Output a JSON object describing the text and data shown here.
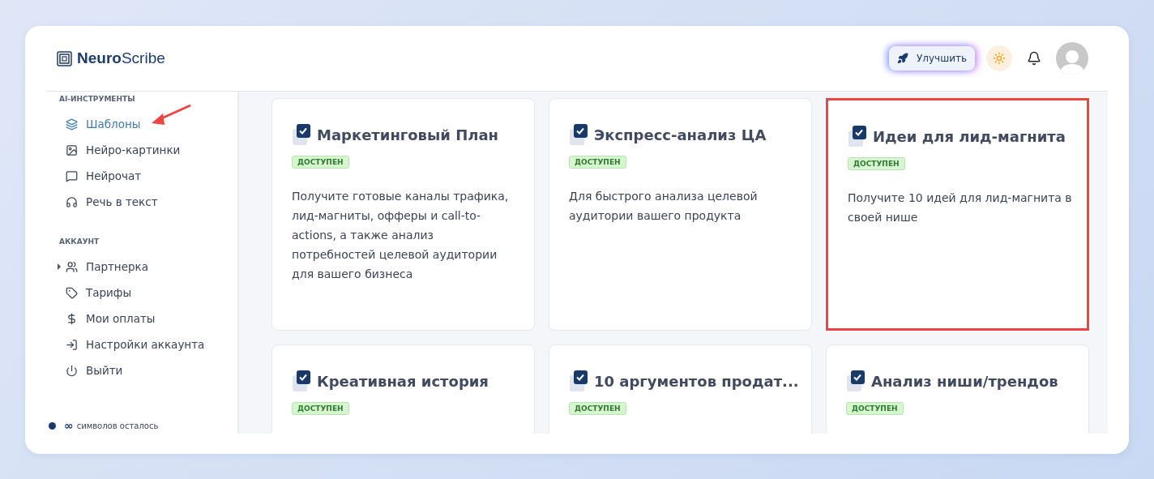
{
  "brand": {
    "name": "**Neuro**Scribe"
  },
  "header": {
    "upgrade_button": "Улучшить"
  },
  "sidebar": {
    "sections": [
      {
        "title": "AI-ИНСТРУМЕНТЫ",
        "items": [
          {
            "label": "Шаблоны",
            "selected": true
          },
          {
            "label": "Нейро-картинки",
            "selected": false
          },
          {
            "label": "Нейрочат",
            "selected": false
          },
          {
            "label": "Речь в текст",
            "selected": false
          }
        ]
      },
      {
        "title": "АККАУНТ",
        "items": [
          {
            "label": "Партнерка",
            "selected": false,
            "expanded": false
          },
          {
            "label": "Тарифы",
            "selected": false
          },
          {
            "label": "Мои оплаты",
            "selected": false
          },
          {
            "label": "Настройки аккаунта",
            "selected": false
          },
          {
            "label": "Выйти",
            "selected": false
          }
        ]
      }
    ],
    "footer": {
      "symbol": "∞",
      "text": "символов осталось"
    }
  },
  "cards": [
    {
      "title": "Маркетинговый План",
      "badge": "ДОСТУПЕН",
      "description": "Получите готовые каналы трафика, лид-магниты, офферы и call-to-actions, а также анализ потребностей целевой аудитории для вашего бизнеса",
      "highlighted": false
    },
    {
      "title": "Экспресс-анализ ЦА",
      "badge": "ДОСТУПЕН",
      "description": "Для быстрого анализа целевой аудитории вашего продукта",
      "highlighted": false
    },
    {
      "title": "Идеи для лид-магнита",
      "badge": "ДОСТУПЕН",
      "description": "Получите 10 идей для лид-магнита в своей нише",
      "highlighted": true
    },
    {
      "title": "Креативная история",
      "badge": "ДОСТУПЕН",
      "highlighted": false
    },
    {
      "title": "10 аргументов продат...",
      "badge": "ДОСТУПЕН",
      "highlighted": false
    },
    {
      "title": "Анализ ниши/трендов",
      "badge": "ДОСТУПЕН",
      "highlighted": false
    }
  ]
}
